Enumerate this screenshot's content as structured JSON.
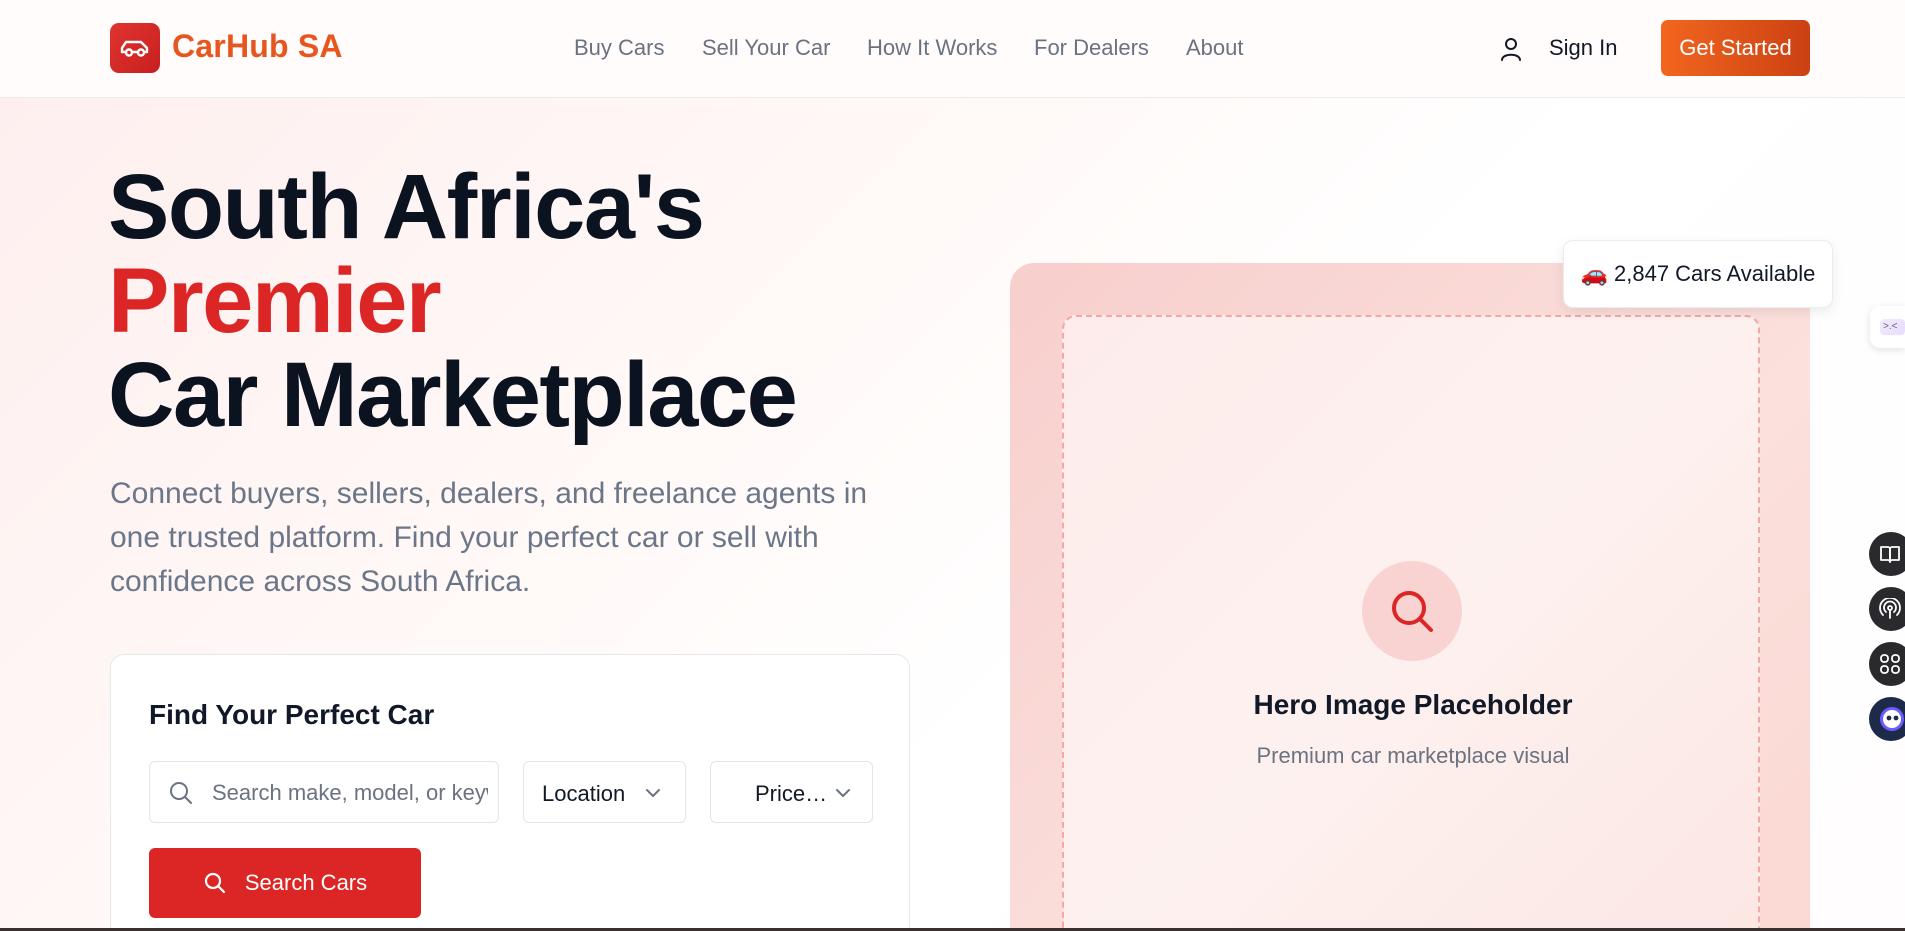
{
  "header": {
    "brand": "CarHub SA",
    "nav": [
      {
        "label": "Buy Cars"
      },
      {
        "label": "Sell Your Car"
      },
      {
        "label": "How It Works"
      },
      {
        "label": "For Dealers"
      },
      {
        "label": "About"
      }
    ],
    "sign_in": "Sign In",
    "get_started": "Get Started"
  },
  "hero": {
    "headline_line1": "South Africa's",
    "headline_line2": "Premier",
    "headline_line3": "Car Marketplace",
    "subtitle": "Connect buyers, sellers, dealers, and freelance agents in one trusted platform. Find your perfect car or sell with confidence across South Africa.",
    "search_card": {
      "title": "Find Your Perfect Car",
      "search_placeholder": "Search make, model, or keyword...",
      "location_label": "Location",
      "price_label": "Price…",
      "search_button": "Search Cars"
    },
    "image": {
      "title": "Hero Image Placeholder",
      "subtitle": "Premium car marketplace visual"
    },
    "badge": {
      "emoji": "🚗",
      "text": "2,847 Cars Available"
    }
  },
  "side_tools": {
    "tab_text": ">.<"
  },
  "colors": {
    "brand_red": "#dc2626",
    "brand_orange": "#e8561f",
    "cta_gradient_start": "#f2661f",
    "cta_gradient_end": "#cc4112"
  }
}
